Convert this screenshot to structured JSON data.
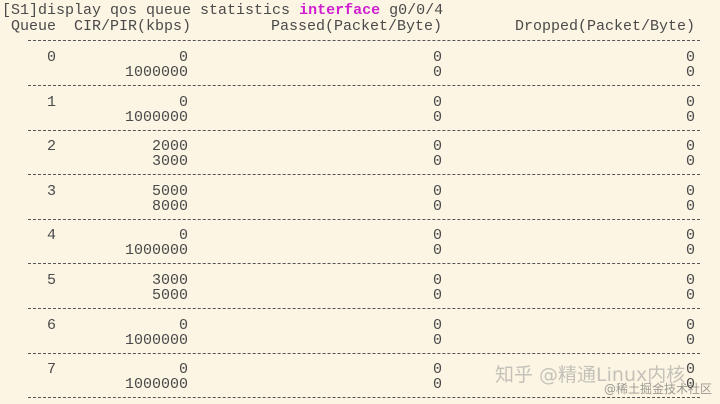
{
  "terminal": {
    "prompt": "[S1]",
    "command": "display qos queue statistics ",
    "keyword": "interface",
    "argument": " g0/0/4",
    "headers": {
      "queue": "Queue",
      "cir_pir": "CIR/PIR(kbps)",
      "passed": "Passed(Packet/Byte)",
      "dropped": "Dropped(Packet/Byte)"
    },
    "rows": [
      {
        "queue": "0",
        "cir": "0",
        "pir": "1000000",
        "passed_packet": "0",
        "passed_byte": "0",
        "dropped_packet": "0",
        "dropped_byte": "0"
      },
      {
        "queue": "1",
        "cir": "0",
        "pir": "1000000",
        "passed_packet": "0",
        "passed_byte": "0",
        "dropped_packet": "0",
        "dropped_byte": "0"
      },
      {
        "queue": "2",
        "cir": "2000",
        "pir": "3000",
        "passed_packet": "0",
        "passed_byte": "0",
        "dropped_packet": "0",
        "dropped_byte": "0"
      },
      {
        "queue": "3",
        "cir": "5000",
        "pir": "8000",
        "passed_packet": "0",
        "passed_byte": "0",
        "dropped_packet": "0",
        "dropped_byte": "0"
      },
      {
        "queue": "4",
        "cir": "0",
        "pir": "1000000",
        "passed_packet": "0",
        "passed_byte": "0",
        "dropped_packet": "0",
        "dropped_byte": "0"
      },
      {
        "queue": "5",
        "cir": "3000",
        "pir": "5000",
        "passed_packet": "0",
        "passed_byte": "0",
        "dropped_packet": "0",
        "dropped_byte": "0"
      },
      {
        "queue": "6",
        "cir": "0",
        "pir": "1000000",
        "passed_packet": "0",
        "passed_byte": "0",
        "dropped_packet": "0",
        "dropped_byte": "0"
      },
      {
        "queue": "7",
        "cir": "0",
        "pir": "1000000",
        "passed_packet": "0",
        "passed_byte": "0",
        "dropped_packet": "0",
        "dropped_byte": "0"
      }
    ]
  },
  "watermarks": {
    "zhihu": "知乎 @精通Linux内核",
    "juejin": "@稀土掘金技术社区"
  }
}
